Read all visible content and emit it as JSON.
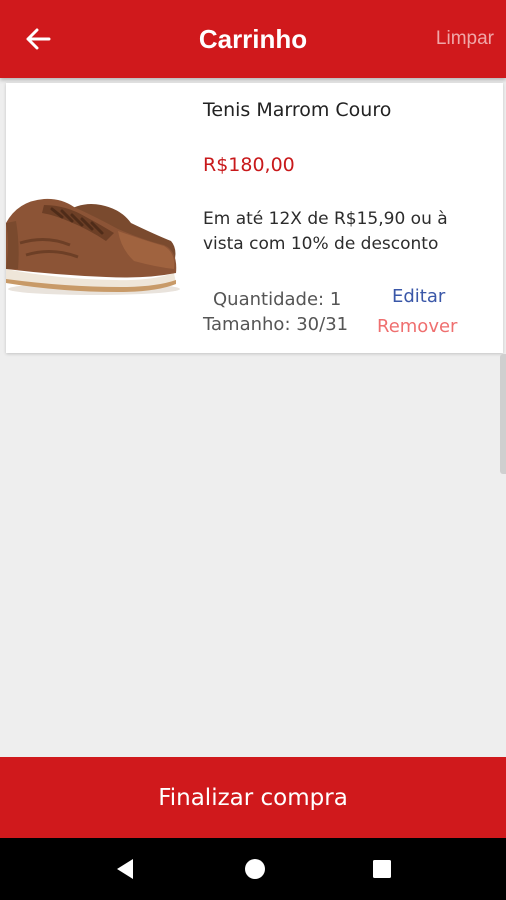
{
  "app_bar": {
    "title": "Carrinho",
    "clear_label": "Limpar",
    "back_icon": "arrow-left-icon",
    "color": "#d0191c"
  },
  "cart": {
    "items": [
      {
        "name": "Tenis Marrom Couro",
        "price": "R$180,00",
        "installments": "Em até 12X de R$15,90 ou à vista com 10% de desconto",
        "quantity": "Quantidade: 1",
        "size": "Tamanho: 30/31",
        "edit_label": "Editar",
        "remove_label": "Remover",
        "image_icon": "brown-leather-sneaker-image"
      }
    ]
  },
  "checkout": {
    "label": "Finalizar compra"
  },
  "system_nav": {
    "back_icon": "nav-back-triangle-icon",
    "home_icon": "nav-home-circle-icon",
    "recents_icon": "nav-recents-square-icon"
  },
  "colors": {
    "brand_red": "#d0191c",
    "price_red": "#c8191b",
    "edit_blue": "#3a57a8",
    "remove_red": "#ef6f6f"
  }
}
